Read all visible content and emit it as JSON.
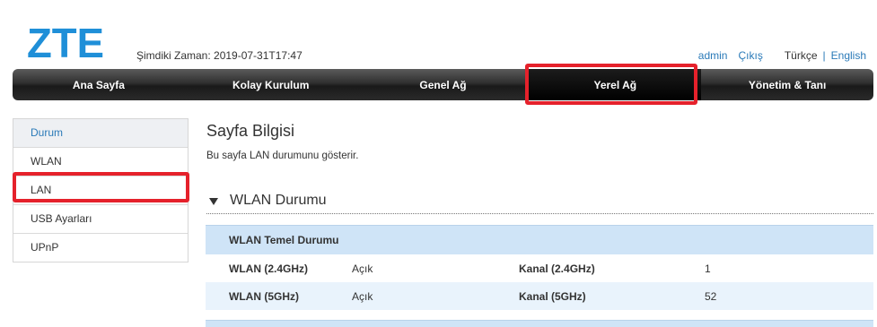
{
  "brand": {
    "logo_text": "ZTE",
    "logo_color": "#1f8fd8"
  },
  "header": {
    "time_label": "Şimdiki Zaman: 2019-07-31T17:47",
    "user": "admin",
    "logout": "Çıkış",
    "lang_current": "Türkçe",
    "lang_sep": "|",
    "lang_other": "English"
  },
  "nav": {
    "items": [
      {
        "label": "Ana Sayfa"
      },
      {
        "label": "Kolay Kurulum"
      },
      {
        "label": "Genel Ağ"
      },
      {
        "label": "Yerel Ağ"
      },
      {
        "label": "Yönetim & Tanı"
      }
    ],
    "active_index": 3
  },
  "sidebar": {
    "items": [
      {
        "label": "Durum"
      },
      {
        "label": "WLAN"
      },
      {
        "label": "LAN"
      },
      {
        "label": "USB Ayarları"
      },
      {
        "label": "UPnP"
      }
    ],
    "active_index": 0
  },
  "main": {
    "title": "Sayfa Bilgisi",
    "description": "Bu sayfa LAN durumunu gösterir.",
    "section_title": "WLAN Durumu",
    "table_header": "WLAN Temel Durumu",
    "rows": [
      {
        "label1": "WLAN (2.4GHz)",
        "value1": "Açık",
        "label2": "Kanal (2.4GHz)",
        "value2": "1"
      },
      {
        "label1": "WLAN (5GHz)",
        "value1": "Açık",
        "label2": "Kanal (5GHz)",
        "value2": "52"
      }
    ]
  },
  "annotation_color": "#e5212b"
}
